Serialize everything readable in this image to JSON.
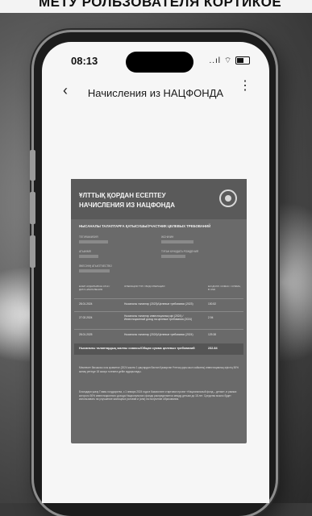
{
  "banner": {
    "text": "МЕТУ РОЛЬЗОВАТЕЛЯ КОРТИКОЕ"
  },
  "status": {
    "time": "08:13",
    "signal": "..ıl",
    "wifi": "⌔"
  },
  "nav": {
    "back": "‹",
    "title": "Начисления из НАЦФОНДА",
    "more": "⋮"
  },
  "doc": {
    "title_kz": "ҰЛТТЫҚ ҚОРДАН ЕСЕПТЕУ",
    "title_ru": "НАЧИСЛЕНИЯ ИЗ НАЦФОНДА",
    "subtitle": "НЫСАНАЛЫ ТАЛАПТАРҒА ҚАТЫСУШЫ/УЧАСТНИК ЦЕЛЕВЫХ ТРЕБОВАНИЙ",
    "fields": {
      "surname": "ТЕГІ/ФАМИЛИЯ",
      "name": "ЕСІМІ/ИМЯ",
      "patronymic": "ӘКЕСІНІҢ АТЫ/ОТЧЕСТВО",
      "birthdate": "ТУҒАН КҮНІ/ДАТА РОЖДЕНИЯ",
      "iin": "ЖСН/ИИН",
      "first_name": "АТЫ/ИМЯ"
    },
    "table": {
      "col_date": "ЕСЕП АУДАРЫЛҒАН КҮНІ / ДАТА НАЧИСЛЕНИЯ",
      "col_type": "ОПЕРАЦИЯ ТҮРІ / ВИД ОПЕРАЦИИ",
      "col_sum": "ЕКІ ДОЛЛ. СОМАС / СУММА, В USD",
      "rows": [
        {
          "date": "28.01.2024",
          "type": "Нысаналы талаптар (2023)/Целевые требования (2023)",
          "sum": "100.52"
        },
        {
          "date": "27.02.2024",
          "type": "Нысаналы талаптар инвестициялық кірі (2024) / Инвестиционный доход на целевые требования (2024)",
          "sum": "2.94"
        },
        {
          "date": "28.01.2025",
          "type": "Нысаналы талаптар (2024)/Целевые требования (2024)",
          "sum": "129.38"
        }
      ],
      "total_label": "Нысаналы талаптардың жалпы сомасы/Общая сумма целевых требований",
      "total_value": "232.84"
    },
    "note1": "Мемлекет басшысы осы қызметке (2024 жылға 1 қаңтардан бастап Қазақстан Ұлттық қоры жыл сайынғы) инвестициялық кірістің 50% жинақ ретінде 18 жасқа толғанға дейін аударылады.",
    "note2": "Благодаря указу Главы государства, с 1 января 2024 года в Казахстане стартовал проект «Национальный фонд – детям», в рамках которого 50% инвестиционного дохода Национального фонда распределяется между детьми до 18 лет. Средства можно будет использовать на улучшение жилищных условий и (или) на получение образования."
  }
}
